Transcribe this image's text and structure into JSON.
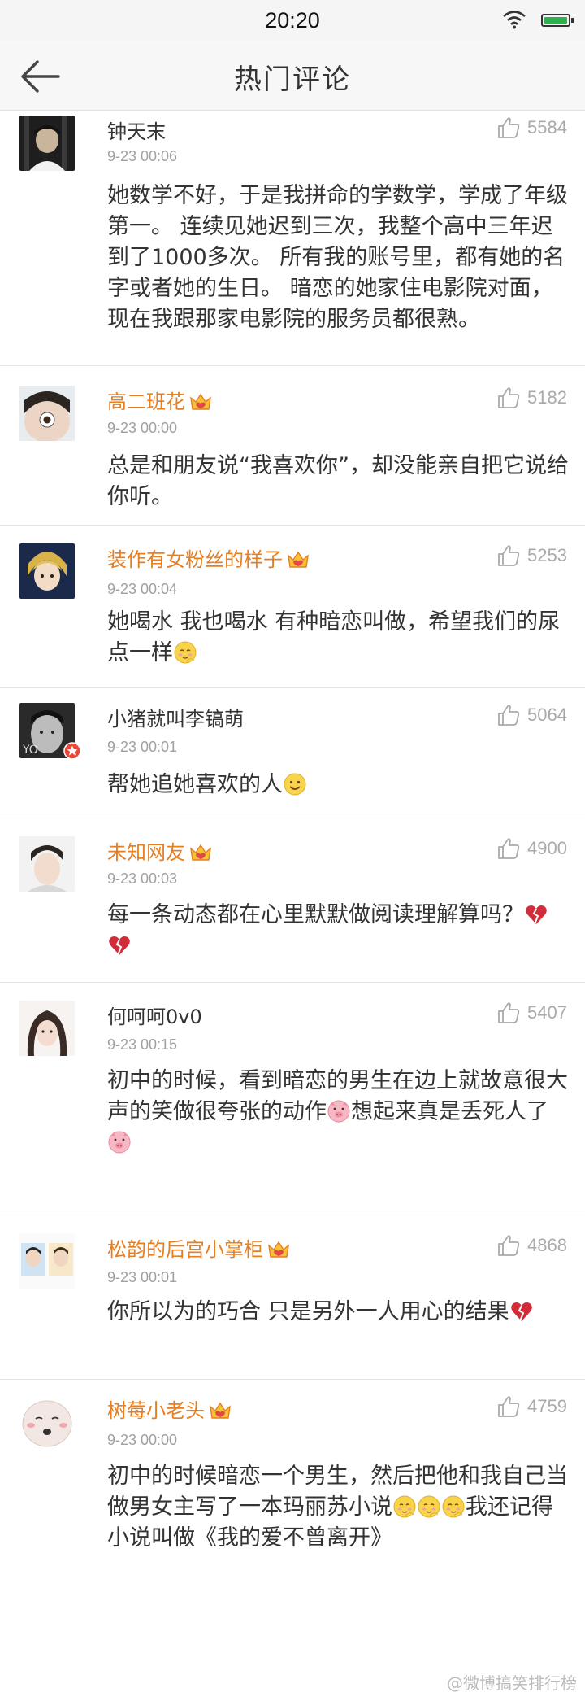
{
  "status_bar": {
    "time": "20:20"
  },
  "header": {
    "title": "热门评论"
  },
  "comments": [
    {
      "user": "钟天末",
      "vip": false,
      "time": "9-23 00:06",
      "likes": "5584",
      "text": "她数学不好，于是我拼命的学数学，学成了年级第一。 连续见她迟到三次，我整个高中三年迟到了1000多次。 所有我的账号里，都有她的名字或者她的生日。 暗恋的她家住电影院对面，现在我跟那家电影院的服务员都很熟。"
    },
    {
      "user": "高二班花",
      "vip": true,
      "time": "9-23 00:00",
      "likes": "5182",
      "text": "总是和朋友说“我喜欢你”，却没能亲自把它说给你听。"
    },
    {
      "user": "装作有女粉丝的样子",
      "vip": true,
      "time": "9-23 00:04",
      "likes": "5253",
      "text_a": "她喝水 我也喝水 有种暗恋叫做，希望我们的尿点一样",
      "emoji_a": "shy-face-emoji"
    },
    {
      "user": "小猪就叫李镐萌",
      "vip": false,
      "time": "9-23 00:01",
      "likes": "5064",
      "text_a": "帮她追她喜欢的人",
      "emoji_a": "smile-face-emoji"
    },
    {
      "user": "未知网友",
      "vip": true,
      "time": "9-23 00:03",
      "likes": "4900",
      "text_a": "每一条动态都在心里默默做阅读理解算吗？",
      "emoji_a": "broken-heart-emoji"
    },
    {
      "user": "何呵呵0v0",
      "vip": false,
      "time": "9-23 00:15",
      "likes": "5407",
      "text_a": "初中的时候，看到暗恋的男生在边上就故意很大声的笑做很夸张的动作",
      "text_b": "想起来真是丢死人了",
      "emoji_a": "pig-emoji"
    },
    {
      "user": "松韵的后宫小掌柜",
      "vip": true,
      "time": "9-23 00:01",
      "likes": "4868",
      "text_a": "你所以为的巧合 只是另外一人用心的结果",
      "emoji_a": "broken-heart-emoji"
    },
    {
      "user": "树莓小老头",
      "vip": true,
      "time": "9-23 00:00",
      "likes": "4759",
      "text_a": "初中的时候暗恋一个男生，然后把他和我自己当做男女主写了一本玛丽苏小说",
      "text_b": "我还记得小说叫做《我的爱不曾离开》",
      "emoji_a": "shy-face-emoji"
    }
  ],
  "watermark": "@微博搞笑排行榜",
  "colors": {
    "vip_name": "#e67e22",
    "like_gray": "#aaaaaa",
    "divider": "#e3e3e3"
  }
}
